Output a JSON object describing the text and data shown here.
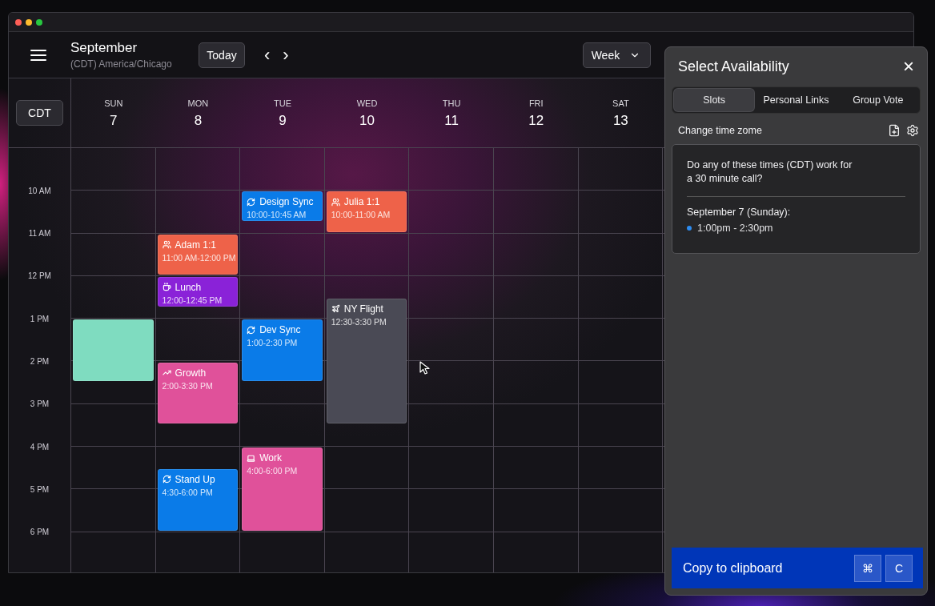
{
  "header": {
    "title": "September",
    "timezone": "(CDT) America/Chicago",
    "today_button": "Today",
    "prev": "‹",
    "next": "›",
    "view_select": "Week"
  },
  "timezone_button": "CDT",
  "hours": [
    "10 AM",
    "11 AM",
    "12 PM",
    "1 PM",
    "2 PM",
    "3 PM",
    "4 PM",
    "5 PM",
    "6 PM"
  ],
  "days": [
    {
      "weekday": "SUN",
      "date": "7",
      "events": [
        {
          "kind": "slot",
          "color": "#7fdcc0"
        }
      ]
    },
    {
      "weekday": "MON",
      "date": "8",
      "events": [
        {
          "kind": "people",
          "title": "Adam 1:1",
          "time": "11:00 AM-12:00 PM",
          "color": "#ee6249"
        },
        {
          "kind": "lunch",
          "title": "Lunch",
          "time": "12:00-12:45 PM",
          "color": "#8a22d8"
        },
        {
          "kind": "growth",
          "title": "Growth",
          "time": "2:00-3:30 PM",
          "color": "#e0519a"
        },
        {
          "kind": "recurring",
          "title": "Stand Up",
          "time": "4:30-6:00 PM",
          "color": "#0a7be8"
        }
      ]
    },
    {
      "weekday": "TUE",
      "date": "9",
      "events": [
        {
          "kind": "recurring",
          "title": "Design Sync",
          "time": "10:00-10:45 AM",
          "color": "#0a7be8"
        },
        {
          "kind": "recurring",
          "title": "Dev Sync",
          "time": "1:00-2:30 PM",
          "color": "#0a7be8"
        },
        {
          "kind": "work",
          "title": "Work",
          "time": "4:00-6:00 PM",
          "color": "#e0519a"
        }
      ]
    },
    {
      "weekday": "WED",
      "date": "10",
      "events": [
        {
          "kind": "people",
          "title": "Julia 1:1",
          "time": "10:00-11:00 AM",
          "color": "#ee6249"
        },
        {
          "kind": "flight",
          "title": "NY Flight",
          "time": "12:30-3:30 PM",
          "color": "#4a4a55"
        }
      ]
    },
    {
      "weekday": "THU",
      "date": "11"
    },
    {
      "weekday": "FRI",
      "date": "12"
    },
    {
      "weekday": "SAT",
      "date": "13"
    }
  ],
  "panel": {
    "title": "Select Availability",
    "close": "×",
    "tabs": [
      {
        "label": "Slots",
        "selected": true
      },
      {
        "label": "Personal Links",
        "selected": false
      },
      {
        "label": "Group Vote",
        "selected": false
      }
    ],
    "change_timezone": "Change time zome",
    "message": "Do any of these times (CDT) work for a 30 minute call?",
    "date_heading": "September 7 (Sunday):",
    "slots": [
      {
        "time": "1:00pm - 2:30pm",
        "color": "#2d8cf0"
      }
    ],
    "copy_button": "Copy to clipboard",
    "shortcut_keys": [
      "⌘",
      "C"
    ]
  }
}
